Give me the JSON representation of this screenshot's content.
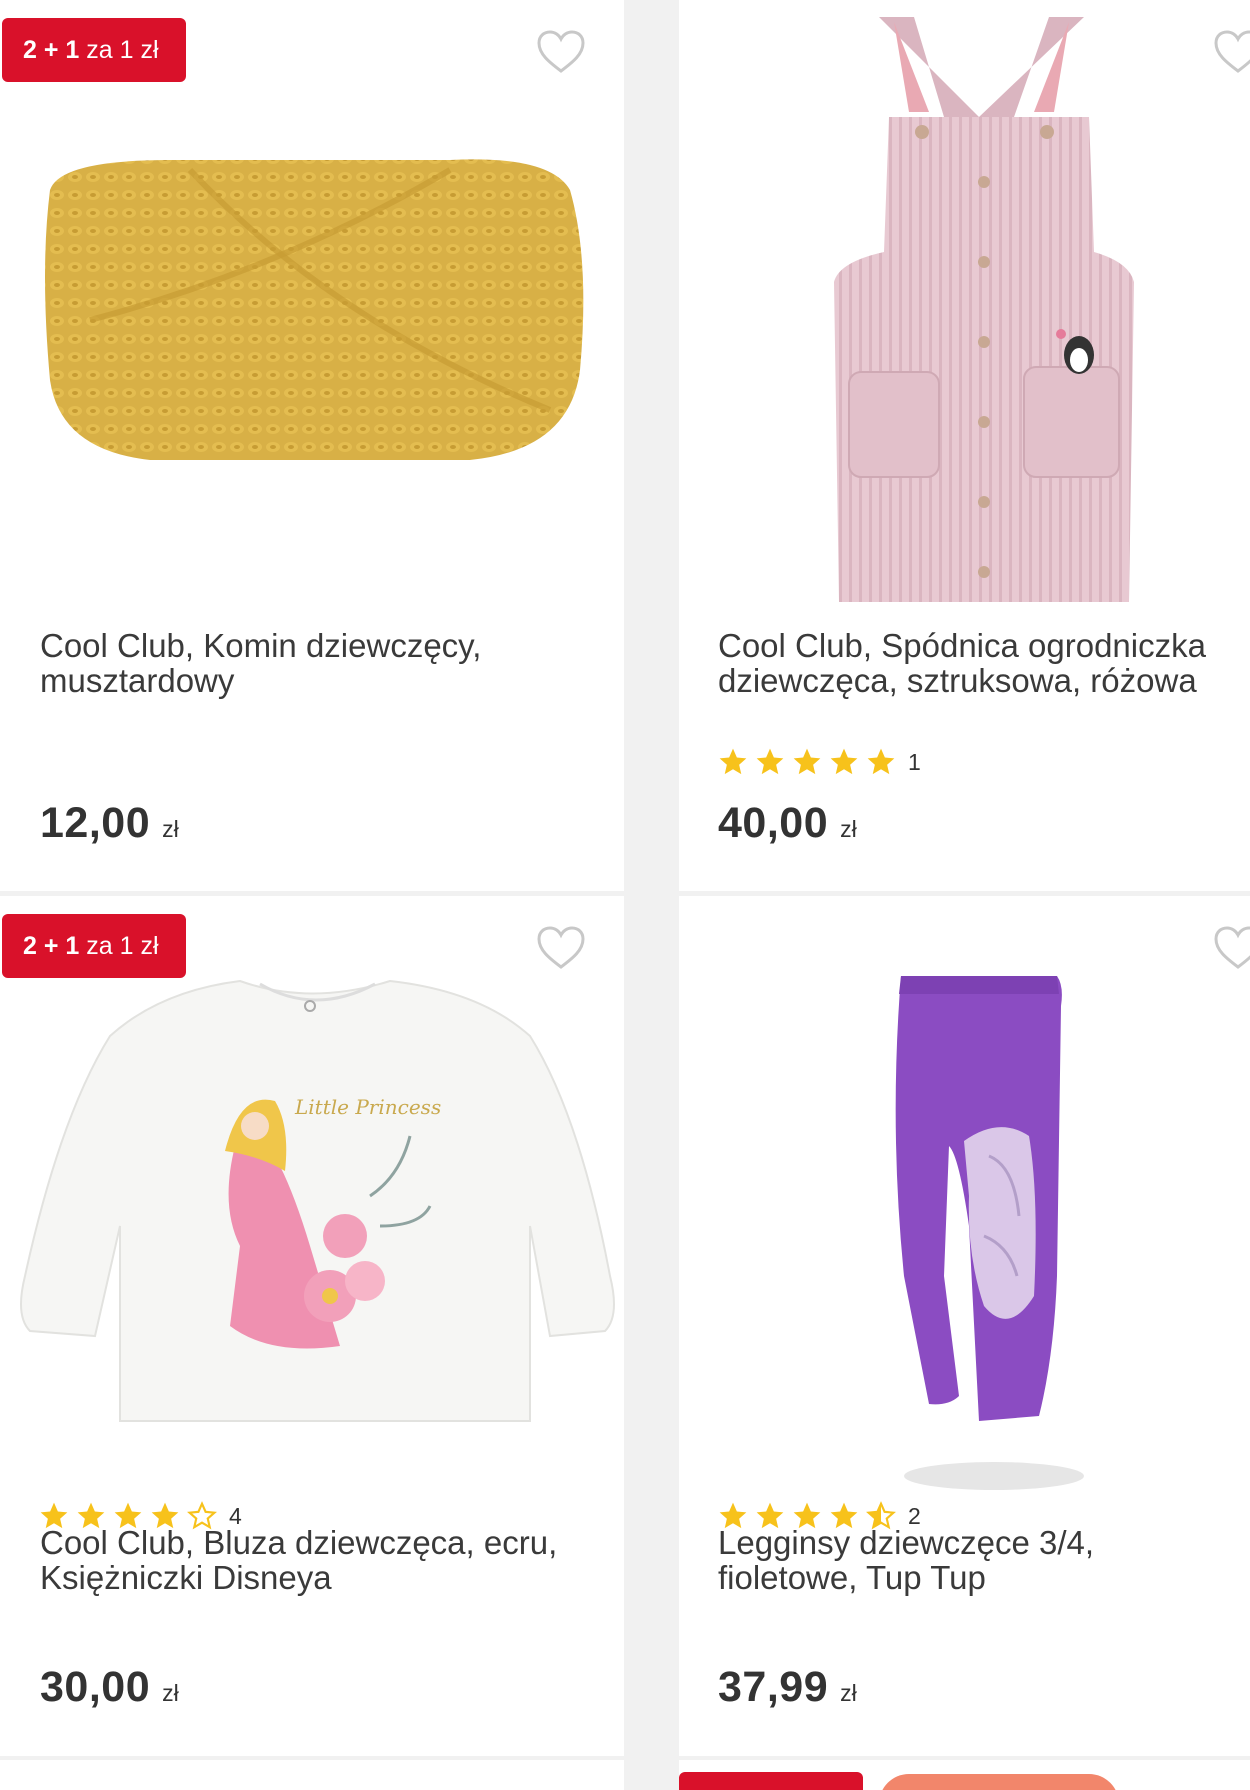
{
  "products": [
    {
      "badge": {
        "bold": "2 + 1",
        "text": "za 1 zł"
      },
      "image": "yellow-knit-headband",
      "title": "Cool Club, Komin dziewczęcy, musztardowy",
      "rating": null,
      "price": {
        "value": "12,00",
        "currency": "zł"
      }
    },
    {
      "badge": null,
      "image": "pink-corduroy-dungaree-dress",
      "title": "Cool Club, Spódnica ogrodniczka dziewczęca, sztruksowa, różowa",
      "rating": {
        "stars": 5,
        "count": "1"
      },
      "price": {
        "value": "40,00",
        "currency": "zł"
      }
    },
    {
      "badge": {
        "bold": "2 + 1",
        "text": "za 1 zł"
      },
      "image": "white-princess-sweatshirt",
      "title": "Cool Club, Bluza dziewczęca, ecru, Księżniczki Disneya",
      "rating": {
        "stars": 4,
        "count": "4"
      },
      "price": {
        "value": "30,00",
        "currency": "zł"
      }
    },
    {
      "badge": null,
      "image": "purple-horse-leggings",
      "title": "Legginsy dziewczęce 3/4, fioletowe, Tup Tup",
      "rating": {
        "stars": 4.5,
        "count": "2"
      },
      "price": {
        "value": "37,99",
        "currency": "zł"
      }
    }
  ],
  "colors": {
    "badge": "#d9112a",
    "star": "#f7c21b",
    "background": "#f1f1f1"
  }
}
